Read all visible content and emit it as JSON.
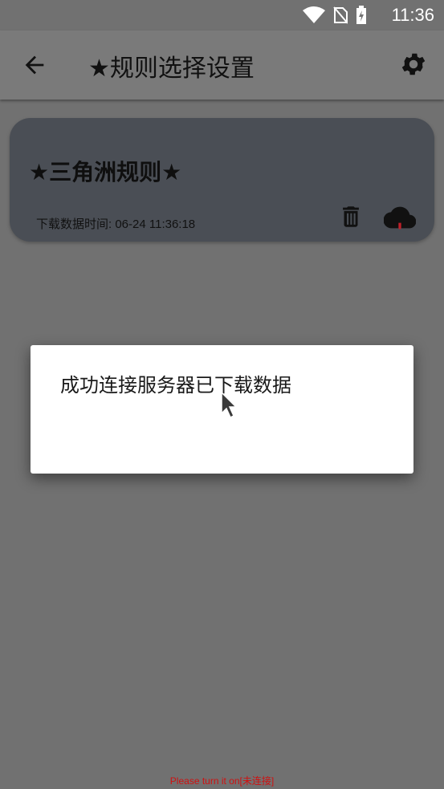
{
  "status_bar": {
    "time": "11:36",
    "icons": [
      "wifi-icon",
      "no-sim-icon",
      "battery-charging-icon"
    ]
  },
  "app_bar": {
    "title": "★规则选择设置",
    "back_icon": "arrow-left-icon",
    "settings_icon": "gear-icon"
  },
  "rule_card": {
    "name": "★三角洲规则★",
    "download_time": "下载数据时间: 06-24 11:36:18",
    "delete_icon": "trash-icon",
    "download_icon": "cloud-download-icon"
  },
  "dialog": {
    "message": "成功连接服务器已下载数据"
  },
  "footer": {
    "text": "Please turn it on[未连接]"
  },
  "colors": {
    "scrim": "#717171",
    "card": "#4a4e55",
    "dialog": "#ffffff",
    "footer_text": "#d01010"
  }
}
